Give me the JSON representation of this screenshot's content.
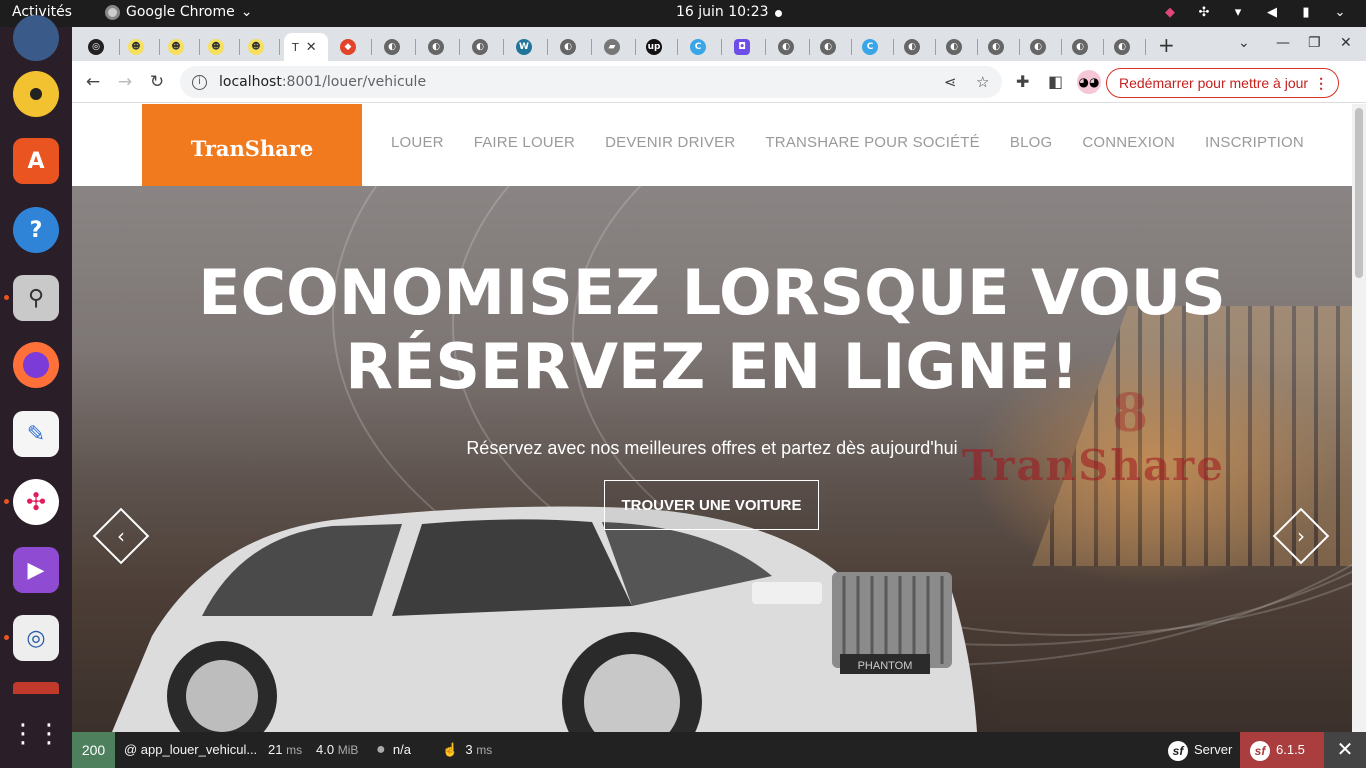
{
  "system": {
    "activities": "Activités",
    "app_name": "Google Chrome",
    "clock": "16 juin  10:23"
  },
  "browser": {
    "url_host": "localhost",
    "url_rest": ":8001/louer/vehicule",
    "update_button": "Redémarrer pour mettre à jour",
    "active_tab_letter": "T"
  },
  "site": {
    "logo": "TranShare",
    "nav": [
      "LOUER",
      "FAIRE LOUER",
      "DEVENIR DRIVER",
      "TRANSHARE POUR SOCIÉTÉ",
      "BLOG",
      "CONNEXION",
      "INSCRIPTION"
    ],
    "hero_title_line1": "ECONOMISEZ LORSQUE VOUS",
    "hero_title_line2": "RÉSERVEZ EN LIGNE!",
    "hero_subtitle": "Réservez avec nos meilleures offres et partez dès aujourd'hui",
    "hero_cta": "TROUVER UNE VOITURE",
    "watermark": "TranShare",
    "car_plate": "PHANTOM"
  },
  "symfony": {
    "status": "200",
    "route": "@ app_louer_vehicul...",
    "time_value": "21",
    "time_unit": "ms",
    "memory_value": "4.0",
    "memory_unit": "MiB",
    "user": "n/a",
    "db_value": "3",
    "db_unit": "ms",
    "server": "Server",
    "version": "6.1.5"
  }
}
